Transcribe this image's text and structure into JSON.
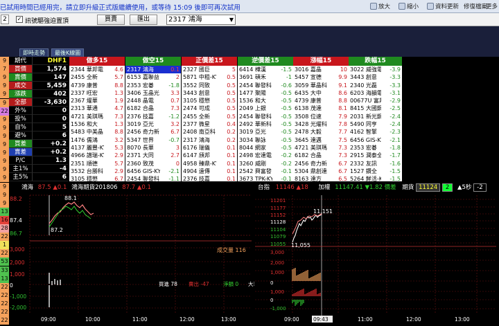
{
  "topbar": {
    "notice": "已試用時間已經用完，請立即升級正式版繼續使用，或等待 15:09 後即可再次試用",
    "buttons": [
      "放大",
      "縮小",
      "資料更新",
      "修復檔案",
      "更多"
    ]
  },
  "toolbar": {
    "left_num": "2",
    "checkbox_label": "訊號驅強迫置頂",
    "btn1": "買賣",
    "btn2": "匯出",
    "stock_select": "2317 鴻海"
  },
  "tabs": [
    "即時走勢",
    "最後K線圖"
  ],
  "left_numbers": [
    {
      "v": "9",
      "bg": "#f5a25c"
    },
    {
      "v": "7",
      "bg": "#f5a25c"
    },
    {
      "v": "9",
      "bg": "#f5a25c"
    },
    {
      "v": "9",
      "bg": "#f5a25c"
    },
    {
      "v": "9",
      "bg": "#f5a25c"
    },
    {
      "v": "9",
      "bg": "#f5a25c"
    },
    {
      "v": "22",
      "bg": "#d57be0"
    },
    {
      "v": "9",
      "bg": "#f5a25c"
    },
    {
      "v": "9",
      "bg": "#f5a25c"
    },
    {
      "v": "9",
      "bg": "#f5a25c"
    },
    {
      "v": "9",
      "bg": "#f5a25c"
    },
    {
      "v": "9",
      "bg": "#f5a25c"
    },
    {
      "v": "9",
      "bg": "#f5a25c"
    },
    {
      "v": "9",
      "bg": "#f5a25c"
    },
    {
      "v": "9",
      "bg": "#f5a25c"
    },
    {
      "v": "9",
      "bg": "#f5a25c"
    },
    {
      "v": "9",
      "bg": "#f5a25c"
    },
    {
      "v": "9",
      "bg": "#f5a25c"
    },
    {
      "v": "13",
      "bg": "#4fc24f"
    },
    {
      "v": "16",
      "bg": "#e2413a"
    },
    {
      "v": "28",
      "bg": "#f2a1a1"
    },
    {
      "v": "22",
      "bg": "#f5a25c"
    },
    {
      "v": "1",
      "bg": "#f0e05a"
    },
    {
      "v": "22",
      "bg": "#f5a25c"
    },
    {
      "v": "53",
      "bg": "#4fc24f"
    },
    {
      "v": "33",
      "bg": "#4fc24f"
    },
    {
      "v": "13",
      "bg": "#4fc24f"
    },
    {
      "v": "22",
      "bg": "#f5a25c"
    },
    {
      "v": "22",
      "bg": "#f5a25c"
    },
    {
      "v": "22",
      "bg": "#f5a25c"
    },
    {
      "v": "22",
      "bg": "#f5a25c"
    },
    {
      "v": "22",
      "bg": "#f5a25c"
    }
  ],
  "quote": [
    {
      "label": "期代",
      "value": "DHF1",
      "lbg": "#000",
      "lc": "#fff",
      "vc": "#ffff33"
    },
    {
      "label": "買價",
      "value": "1,574",
      "lbg": "#b31b1b",
      "lc": "#fff",
      "vc": "#fff"
    },
    {
      "label": "賣價",
      "value": "147",
      "lbg": "#1f8a1f",
      "lc": "#fff",
      "vc": "#fff"
    },
    {
      "label": "成交",
      "value": "5,459",
      "lbg": "#b31b1b",
      "lc": "#fff",
      "vc": "#fff"
    },
    {
      "label": "漲跌",
      "value": "402",
      "lbg": "#1f8a1f",
      "lc": "#fff",
      "vc": "#fff"
    },
    {
      "label": "全部",
      "value": "-3,630",
      "lbg": "#b31b1b",
      "lc": "#fff",
      "vc": "#fff"
    },
    {
      "label": "外%",
      "value": "0",
      "lbg": "#000",
      "lc": "#fff",
      "vc": "#fff"
    },
    {
      "label": "投%",
      "value": "0",
      "lbg": "#000",
      "lc": "#fff",
      "vc": "#fff"
    },
    {
      "label": "自%",
      "value": "5",
      "lbg": "#000",
      "lc": "#fff",
      "vc": "#fff"
    },
    {
      "label": "避%",
      "value": "6",
      "lbg": "#000",
      "lc": "#fff",
      "vc": "#fff"
    },
    {
      "label": "買差",
      "value": "+0.2",
      "lbg": "#1f8a1f",
      "lc": "#fff",
      "vc": "#fff"
    },
    {
      "label": "賣差",
      "value": "+0.2",
      "lbg": "#1f3fb0",
      "lc": "#fff",
      "vc": "#fff"
    },
    {
      "label": "P/C",
      "value": "1.3",
      "lbg": "#000",
      "lc": "#fff",
      "vc": "#fff"
    },
    {
      "label": "主1%",
      "value": "-4",
      "lbg": "#000",
      "lc": "#fff",
      "vc": "#fff"
    },
    {
      "label": "主5%",
      "value": "6",
      "lbg": "#000",
      "lc": "#fff",
      "vc": "#fff"
    }
  ],
  "rankings": [
    {
      "title": "做多15",
      "bg": "#c8161c",
      "rows": [
        [
          "2344 華邦電",
          "4.6"
        ],
        [
          "2455 全新",
          "5.7"
        ],
        [
          "4739 康普",
          "8.8"
        ],
        [
          "2337 旺宏",
          "1.3"
        ],
        [
          "2367 燿華",
          "1.9"
        ],
        [
          "2313 華通",
          "4.7"
        ],
        [
          "4721 美琪瑪",
          "7.3"
        ],
        [
          "1536 和大",
          "1.3"
        ],
        [
          "5483 中美晶",
          "8.8"
        ],
        [
          "1476 儒鴻",
          "3.2"
        ],
        [
          "4137 麗豐-KY",
          "5.3"
        ],
        [
          "4966 譜瑞-KY",
          "2.9"
        ],
        [
          "2351 順德",
          "5.7"
        ],
        [
          "3532 台勝科",
          "2.9"
        ],
        [
          "3105 穩懋",
          "6.7"
        ]
      ]
    },
    {
      "title": "做空15",
      "bg": "#1f8a1f",
      "rows": [
        [
          "2317 鴻海",
          "0.1"
        ],
        [
          "6153 嘉聯益",
          "2"
        ],
        [
          "2353 宏碁",
          "-1.8"
        ],
        [
          "3406 玉晶光",
          "3.3"
        ],
        [
          "2448 晶電",
          "0.7"
        ],
        [
          "6182 合晶",
          "7.3"
        ],
        [
          "2376 技嘉",
          "-1.2"
        ],
        [
          "3019 亞光",
          "3.2"
        ],
        [
          "2456 奇力新",
          "6.7"
        ],
        [
          "5347 世界",
          "-0.7"
        ],
        [
          "8070 長華",
          "3"
        ],
        [
          "2371 大同",
          "2.7"
        ],
        [
          "2360 致茂",
          "0"
        ],
        [
          "6456 GIS-KY",
          "-2.1"
        ],
        [
          "2454 聯發科",
          "-1.1"
        ]
      ]
    },
    {
      "title": "正價差15",
      "bg": "#c8161c",
      "rows": [
        [
          "2327 國巨",
          "5"
        ],
        [
          "5871 中租-KY",
          "0.5"
        ],
        [
          "3552 同致",
          "0.5"
        ],
        [
          "3443 創意",
          "0.5"
        ],
        [
          "3105 穩懋",
          "0.5"
        ],
        [
          "2474 可成",
          "0.5"
        ],
        [
          "2455 全新",
          "0.5"
        ],
        [
          "2377 微星",
          "0.4"
        ],
        [
          "2408 南亞科",
          "0.2"
        ],
        [
          "2317 鴻海",
          "0.2"
        ],
        [
          "6176 瑞儀",
          "0.1"
        ],
        [
          "6147 頎邦",
          "0.1"
        ],
        [
          "4958 臻鼎-KY",
          "0.1"
        ],
        [
          "4904 遠傳",
          "0.1"
        ],
        [
          "2376 技嘉",
          "0.1"
        ]
      ]
    },
    {
      "title": "逆價差15",
      "bg": "#1f8a1f",
      "rows": [
        [
          "6414 樺漢",
          "-1.5"
        ],
        [
          "3691 碩禾",
          "-1"
        ],
        [
          "2454 聯發科",
          "-0.6"
        ],
        [
          "1477 聚陽",
          "-0.5"
        ],
        [
          "1536 和大",
          "-0.5"
        ],
        [
          "2049 上銀",
          "-0.5"
        ],
        [
          "2454 聯發科",
          "-0.5"
        ],
        [
          "2492 華新科",
          "-0.5"
        ],
        [
          "3019 亞光",
          "-0.5"
        ],
        [
          "3034 聯詠",
          "-0.5"
        ],
        [
          "8044 網家",
          "-0.5"
        ],
        [
          "2498 宏達電",
          "-0.2"
        ],
        [
          "3260 威剛",
          "-0.2"
        ],
        [
          "2542 興富發",
          "-0.1"
        ],
        [
          "3673 TPK-KY",
          "-0.1"
        ]
      ]
    },
    {
      "title": "漲幅15",
      "bg": "#c8161c",
      "rows": [
        [
          "3016 嘉晶",
          "10"
        ],
        [
          "5457 宣德",
          "9.9"
        ],
        [
          "3059 華晶科",
          "9.1"
        ],
        [
          "6435 大中",
          "8.6"
        ],
        [
          "4739 康普",
          "8.8"
        ],
        [
          "6138 茂達",
          "8.1"
        ],
        [
          "3508 位速",
          "7.9"
        ],
        [
          "3428 光燿科",
          "7.8"
        ],
        [
          "2478 大毅",
          "7.7"
        ],
        [
          "3645 達邁",
          "7.5"
        ],
        [
          "4721 美琪瑪",
          "7.3"
        ],
        [
          "6182 合晶",
          "7.3"
        ],
        [
          "2456 奇力新",
          "6.7"
        ],
        [
          "5304 鼎創達",
          "6.7"
        ],
        [
          "8163 達方",
          "6.5"
        ]
      ]
    },
    {
      "title": "跌幅15",
      "bg": "#1f8a1f",
      "rows": [
        [
          "3022 威強電",
          "-3.9"
        ],
        [
          "3443 創意",
          "-3.3"
        ],
        [
          "2340 光磊",
          "-3.3"
        ],
        [
          "6203 海韻電",
          "-3.1"
        ],
        [
          "00677U 富邦",
          "-2.9"
        ],
        [
          "8415 大國鋼",
          "-2.5"
        ],
        [
          "2031 新光鋼",
          "-2.4"
        ],
        [
          "5490 同亨",
          "-2.4"
        ],
        [
          "4162 智擎",
          "-2.3"
        ],
        [
          "6456 GIS-KY",
          "-2.1"
        ],
        [
          "2353 宏碁",
          "-1.8"
        ],
        [
          "2915 潤泰全",
          "-1.7"
        ],
        [
          "2332 友訊",
          "-1.6"
        ],
        [
          "1527 鑽全",
          "-1.5"
        ],
        [
          "5264 鮮活-KY",
          "-1.5"
        ]
      ]
    }
  ],
  "chart_left": {
    "header_name": "鴻海",
    "header_price": "87.5 ▲0.1",
    "header_fut": "鴻海期貨201806",
    "header_fut_price": "87.7 ▲0.1",
    "price_labels": [
      "88.2",
      "87.4",
      "86.7"
    ],
    "hi_label": "88.1",
    "lo_label": "87.2",
    "vol_labels": [
      "3,000",
      "2,000",
      "1,000",
      "0",
      "-1,000",
      "-2,000"
    ],
    "vol_text": "成交量 116",
    "legend": [
      {
        "t": "買進 78",
        "c": "#ffffff"
      },
      {
        "t": "賣出 -47",
        "c": "#e03030"
      },
      {
        "t": "淨額 0",
        "c": "#30d030"
      },
      {
        "t": "大單 0",
        "c": "#ffffff"
      }
    ],
    "time_labels": [
      "09:00",
      "10:00",
      "11:00",
      "12:00",
      "13:00",
      "13:30"
    ]
  },
  "chart_right": {
    "header_name": "台指",
    "header_val": "11146 ▲18",
    "header_wt": "加權",
    "header_wt_val": "11147.41 ▼1.82 價差",
    "header_fut": "期貨",
    "header_fut_box": "11124",
    "header_box2": "2",
    "header_5s": "▲5秒",
    "header_box3": "-2",
    "price_labels": [
      "11201",
      "11177",
      "11152",
      "11128",
      "11104",
      "11079",
      "11055"
    ],
    "hi_label": "11,151",
    "lo_label": "11,055",
    "vol_labels": [
      "3,000",
      "2,000",
      "1,000",
      "0",
      "2,000",
      "1,000",
      "0",
      "-1,000"
    ],
    "time_labels": [
      "09:00",
      "09:43",
      "11:00",
      "12:00",
      "13:00"
    ]
  },
  "colors": {
    "up": "#e03030",
    "down": "#30c030",
    "bg": "#000000",
    "grid": "#5a1010"
  }
}
